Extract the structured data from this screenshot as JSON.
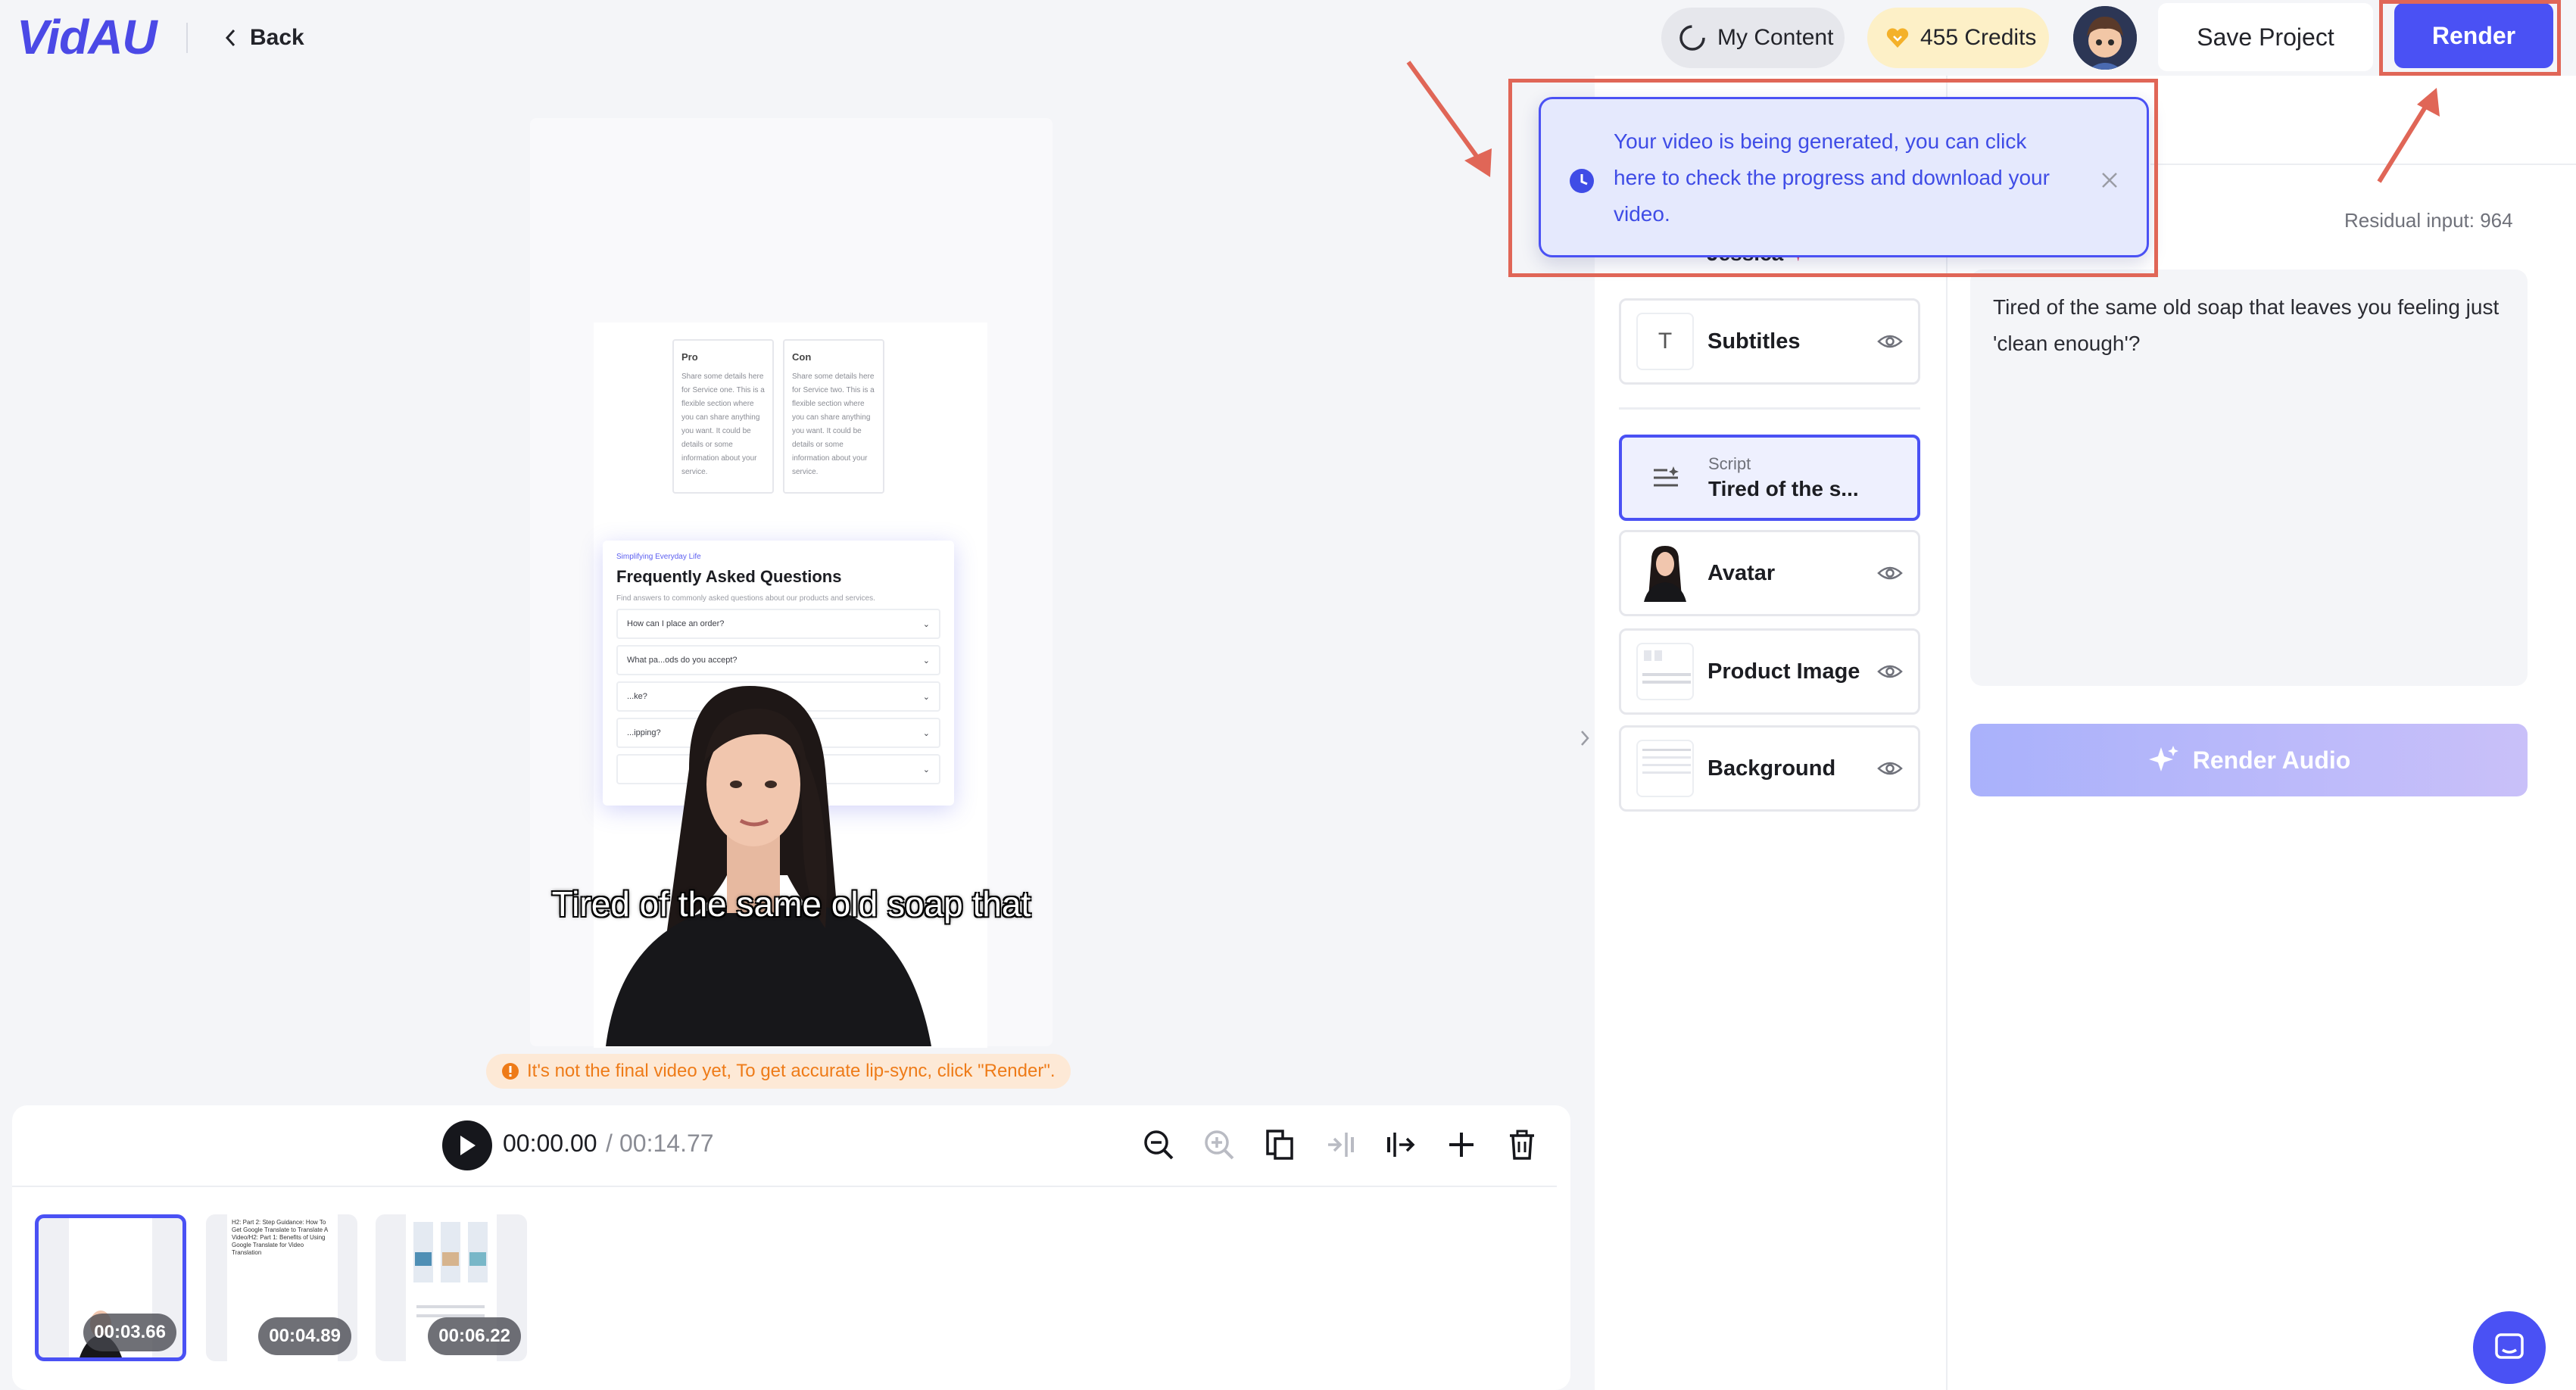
{
  "header": {
    "logo": "VidAU",
    "back_label": "Back",
    "my_content_label": "My Content",
    "credits_label": "455 Credits",
    "save_project_label": "Save Project",
    "render_label": "Render"
  },
  "toast": {
    "message": "Your video is being generated, you can click here to check the progress and download your video."
  },
  "preview": {
    "pros_title": "Pro",
    "pros_body": "Share some details here for Service one. This is a flexible section where you can share anything you want. It could be details or some information about your service.",
    "cons_title": "Con",
    "cons_body": "Share some details here for Service two. This is a flexible section where you can share anything you want. It could be details or some information about your service.",
    "faq_kicker": "Simplifying Everyday Life",
    "faq_title": "Frequently Asked Questions",
    "faq_subtitle": "Find answers to commonly asked questions about our products and services.",
    "faq_questions": [
      "How can I place an order?",
      "What pa...ods do you accept?",
      "...ke?",
      "...ipping?",
      ""
    ],
    "caption": "Tired of the same old soap that",
    "warning": "It's not the final video yet, To get accurate lip-sync, click \"Render\"."
  },
  "timeline": {
    "current_time": "00:00.00",
    "separator": "/",
    "total_time": "00:14.77",
    "clips": [
      {
        "duration": "00:03.66"
      },
      {
        "duration": "00:04.89"
      },
      {
        "duration": "00:06.22"
      }
    ],
    "clip2_text": "H2: Part 2: Step Guidance: How To Get Google Translate to Translate A Video/H2: Part 1: Benefits of Using Google Translate for Video Translation"
  },
  "layers": {
    "avatar_name": "Jessica",
    "subtitles_label": "Subtitles",
    "script_kicker": "Script",
    "script_label": "Tired of the s...",
    "avatar_label": "Avatar",
    "product_image_label": "Product Image",
    "background_label": "Background"
  },
  "script_panel": {
    "residual_input": "Residual input: 964",
    "script_text": "Tired of the same old soap that leaves you feeling just 'clean enough'?",
    "render_audio_label": "Render Audio"
  },
  "colors": {
    "accent": "#4a51f4",
    "highlight": "#e06657",
    "warning": "#ee7b18"
  }
}
